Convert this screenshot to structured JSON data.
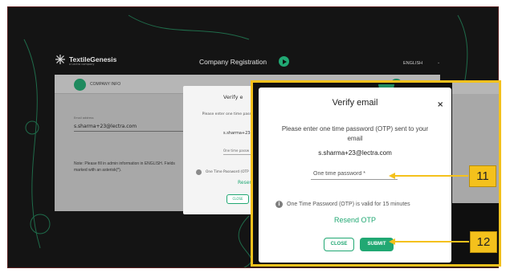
{
  "header": {
    "brand": "TextileGenesis",
    "brand_sub": "a Lectra company",
    "title": "Company Registration",
    "language": "ENGLISH"
  },
  "company_card": {
    "section_label": "COMPANY INFO",
    "email_label": "Email address",
    "email_value": "s.sharma+23@lectra.com",
    "note": "Note: Please fill in admin information in ENGLISH. Fields marked with an asterisk(*)."
  },
  "background_dialog": {
    "title": "Verify e",
    "message": "Please enter one time passw email",
    "email": "s.sharma+23@",
    "otp_placeholder": "One time passw",
    "validity": "One Time Password (OTP",
    "resend": "Resend",
    "close": "CLOSE"
  },
  "dialog": {
    "title": "Verify email",
    "close_glyph": "×",
    "message": "Please enter one time password (OTP) sent to your email",
    "email": "s.sharma+23@lectra.com",
    "otp_placeholder": "One time password *",
    "info_glyph": "i",
    "validity": "One Time Password (OTP) is valid for 15 minutes",
    "resend_label": "Resend OTP",
    "close_label": "CLOSE",
    "submit_label": "SUBMIT"
  },
  "callouts": [
    {
      "number": "11"
    },
    {
      "number": "12"
    }
  ],
  "colors": {
    "accent_green": "#21a873",
    "callout_yellow": "#f4c11c",
    "background_dark": "#141414"
  }
}
